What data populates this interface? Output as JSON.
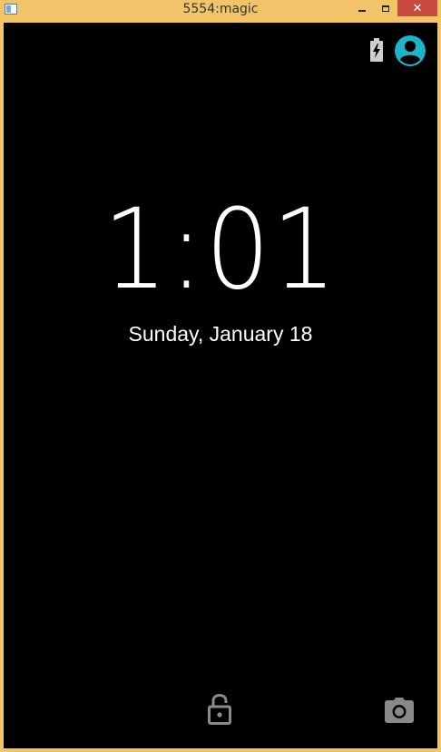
{
  "window": {
    "title": "5554:magic",
    "close_glyph": "✕"
  },
  "lockscreen": {
    "time": "1:01",
    "date": "Sunday, January 18"
  },
  "icons": {
    "status": [
      "battery-charging-icon",
      "user-avatar-icon"
    ],
    "bottom": [
      "unlock-icon",
      "camera-icon"
    ]
  },
  "colors": {
    "titlebar": "#f2c46a",
    "close_button": "#c74a3d",
    "screen_background": "#000000",
    "avatar_accent": "#1fb2c9",
    "bottom_icons": "#8a8a8a"
  }
}
